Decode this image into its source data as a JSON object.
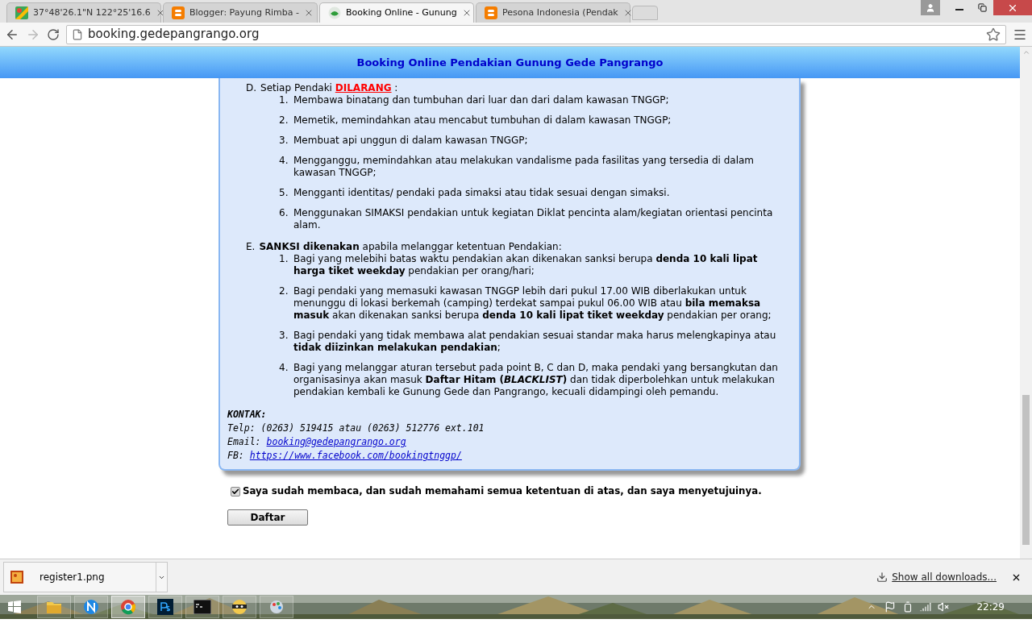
{
  "browser": {
    "tabs": [
      {
        "title": "37°48'26.1\"N 122°25'16.6",
        "kind": "map",
        "selected": false
      },
      {
        "title": "Blogger: Payung Rimba -",
        "kind": "blogger",
        "selected": false
      },
      {
        "title": "Booking Online - Gunung",
        "kind": "site",
        "selected": true
      },
      {
        "title": "Pesona Indonesia (Pendak",
        "kind": "blogger",
        "selected": false
      }
    ],
    "address": "booking.gedepangrango.org"
  },
  "header": {
    "title": "Booking Online Pendakian Gunung Gede Pangrango"
  },
  "sections": [
    {
      "marker": "D.",
      "heading": [
        {
          "text": "Setiap Pendaki ",
          "kind": "plain"
        },
        {
          "text": "DILARANG",
          "kind": "alert"
        },
        {
          "text": " :",
          "kind": "plain"
        }
      ],
      "items": [
        {
          "number": "1.",
          "text": "Membawa binatang dan tumbuhan dari luar dan dari dalam kawasan TNGGP;"
        },
        {
          "number": "2.",
          "text": "Memetik, memindahkan atau mencabut tumbuhan di dalam kawasan TNGGP;"
        },
        {
          "number": "3.",
          "text": "Membuat api unggun di dalam kawasan TNGGP;"
        },
        {
          "number": "4.",
          "text": "Mengganggu, memindahkan atau melakukan vandalisme pada fasilitas yang tersedia di dalam kawasan TNGGP;"
        },
        {
          "number": "5.",
          "text": "Mengganti identitas/ pendaki pada simaksi atau tidak sesuai dengan simaksi."
        },
        {
          "number": "6.",
          "text": "Menggunakan SIMAKSI pendakian untuk kegiatan Diklat pencinta alam/kegiatan orientasi pencinta alam."
        }
      ]
    },
    {
      "marker": "E.",
      "heading": [
        {
          "text": "SANKSI dikenakan",
          "kind": "bold"
        },
        {
          "text": " apabila melanggar ketentuan Pendakian:",
          "kind": "plain"
        }
      ],
      "items": [
        {
          "number": "1.",
          "text": "Bagi yang melebihi batas waktu pendakian akan dikenakan sanksi berupa **denda 10 kali lipat harga tiket weekday** pendakian per orang/hari;"
        },
        {
          "number": "2.",
          "text": "Bagi pendaki yang memasuki kawasan TNGGP lebih dari pukul 17.00 WIB diberlakukan untuk menunggu di lokasi berkemah (camping) terdekat sampai pukul 06.00 WIB atau **bila memaksa masuk** akan dikenakan sanksi berupa **denda 10 kali lipat tiket weekday** pendakian per orang;"
        },
        {
          "number": "3.",
          "text": "Bagi pendaki yang tidak membawa alat pendakian sesuai standar maka harus melengkapinya atau **tidak diizinkan melakukan pendakian**;"
        },
        {
          "number": "4.",
          "text": "Bagi yang melanggar aturan tersebut pada point B, C dan D, maka pendaki yang bersangkutan dan organisasinya akan masuk **Daftar Hitam (*BLACKLIST*)** dan tidak diperbolehkan untuk melakukan pendakian kembali ke Gunung Gede dan Pangrango, kecuali didampingi oleh pemandu."
        }
      ]
    }
  ],
  "contact": {
    "title": "KONTAK:",
    "lines": [
      {
        "kind": "text",
        "label": "Telp: (0263) 519415 atau (0263) 512776 ext.101"
      },
      {
        "kind": "link",
        "label": "Email:",
        "link": "booking@gedepangrango.org"
      },
      {
        "kind": "link",
        "label": "FB:",
        "link": "https://www.facebook.com/bookingtnggp/"
      }
    ]
  },
  "agreement": {
    "checked": true,
    "text": "Saya sudah membaca, dan sudah memahami semua ketentuan di atas, dan saya menyetujuinya."
  },
  "submit_button": "Daftar",
  "downloads": {
    "file": "register1.png",
    "show_all": "Show all downloads..."
  },
  "taskbar": {
    "apps": [
      {
        "kind": "explorer",
        "selected": false
      },
      {
        "kind": "n",
        "selected": false
      },
      {
        "kind": "chrome",
        "selected": true
      },
      {
        "kind": "ps",
        "selected": false
      },
      {
        "kind": "cmd",
        "selected": false
      },
      {
        "kind": "ninja",
        "selected": false
      },
      {
        "kind": "paint",
        "selected": false
      }
    ],
    "clock": "22:29"
  }
}
